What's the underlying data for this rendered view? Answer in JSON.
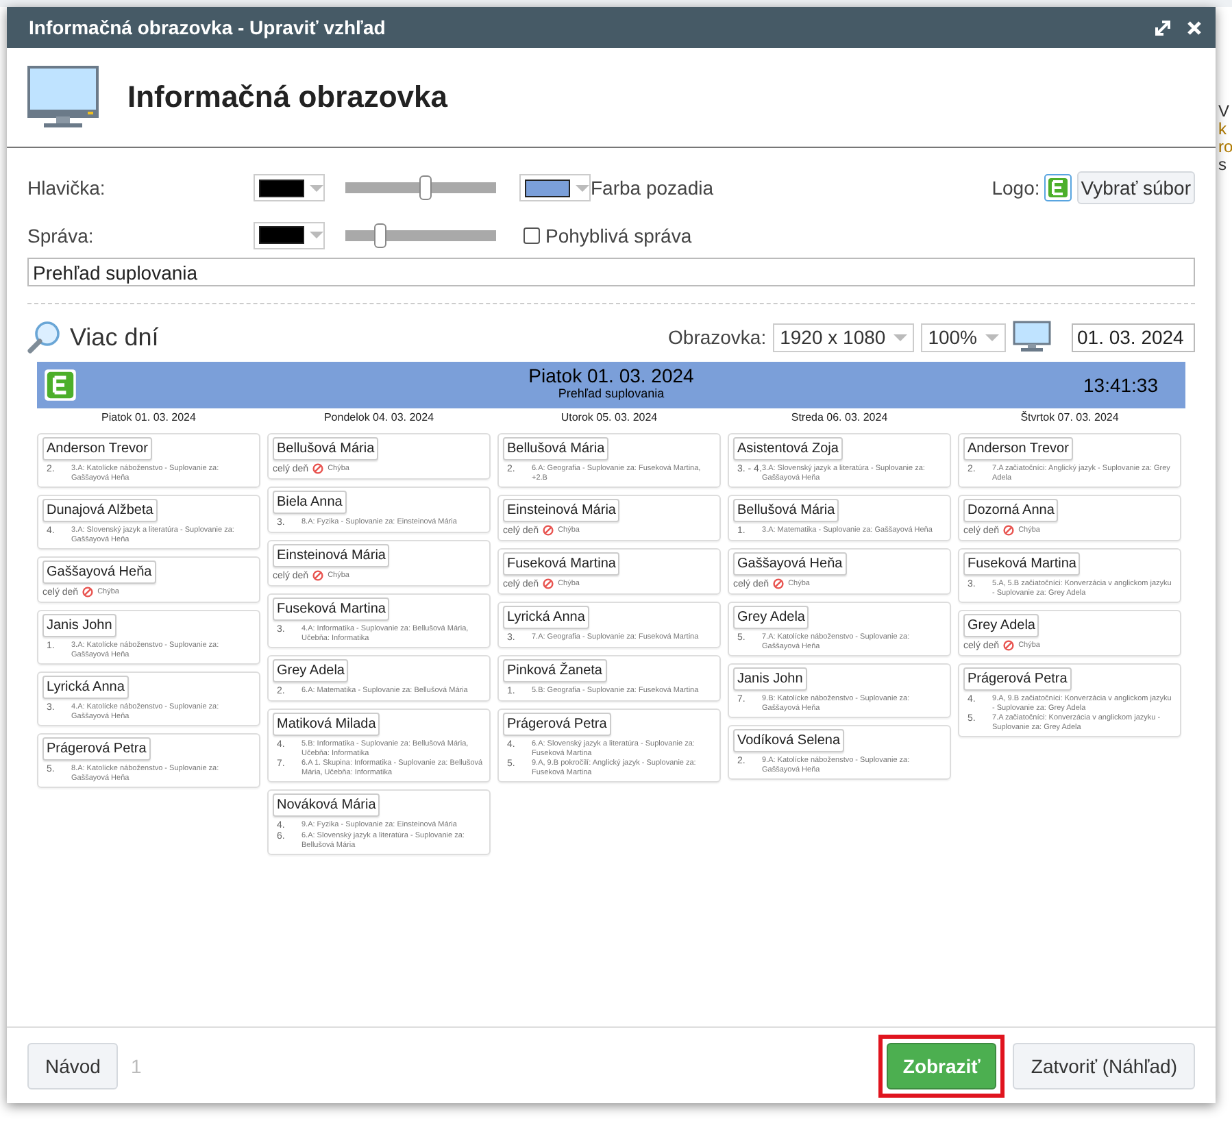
{
  "background": {
    "side_text": [
      "V",
      "k",
      "ro",
      "s"
    ]
  },
  "window": {
    "title": "Informačná obrazovka - Upraviť vzhľad"
  },
  "heading": "Informačná obrazovka",
  "settings": {
    "header": {
      "label": "Hlavička:",
      "text_picker": {
        "color": "#000000"
      },
      "level": 0.54,
      "bg_picker": {
        "color": "#7b9fd9"
      },
      "bg_label": "Farba pozadia"
    },
    "message": {
      "label": "Správa:",
      "text_picker": {
        "color": "#000000"
      },
      "level": 0.24,
      "moving_label": "Pohyblivá správa",
      "moving_checked": false
    },
    "logo_label": "Logo:",
    "file_button": "Vybrať súbor",
    "message_value": "Prehľad suplovania"
  },
  "toolbar": {
    "mode": "Viac dní",
    "screen_label": "Obrazovka:",
    "resolution": "1920 x 1080",
    "zoom": "100%",
    "date": "01. 03. 2024"
  },
  "preview": {
    "date": "Piatok 01. 03. 2024",
    "subtitle": "Prehľad suplovania",
    "time": "13:41:33",
    "days": [
      {
        "title": "Piatok 01. 03. 2024",
        "entries": [
          {
            "name": "Anderson Trevor",
            "kind": "lessons",
            "lessons": [
              {
                "period": "2.",
                "text": "3.A: Katolícke náboženstvo - Suplovanie za: Gaššayová Heňa"
              }
            ]
          },
          {
            "name": "Dunajová Alžbeta",
            "kind": "lessons",
            "lessons": [
              {
                "period": "4.",
                "text": "3.A: Slovenský jazyk a literatúra - Suplovanie za: Gaššayová Heňa"
              }
            ]
          },
          {
            "name": "Gaššayová Heňa",
            "kind": "absent",
            "all_day": "celý deň",
            "status": "Chýba"
          },
          {
            "name": "Janis John",
            "kind": "lessons",
            "lessons": [
              {
                "period": "1.",
                "text": "3.A: Katolícke náboženstvo - Suplovanie za: Gaššayová Heňa"
              }
            ]
          },
          {
            "name": "Lyrická Anna",
            "kind": "lessons",
            "lessons": [
              {
                "period": "3.",
                "text": "4.A: Katolícke náboženstvo - Suplovanie za: Gaššayová Heňa"
              }
            ]
          },
          {
            "name": "Prágerová Petra",
            "kind": "lessons",
            "lessons": [
              {
                "period": "5.",
                "text": "8.A: Katolícke náboženstvo - Suplovanie za: Gaššayová Heňa"
              }
            ]
          }
        ]
      },
      {
        "title": "Pondelok 04. 03. 2024",
        "entries": [
          {
            "name": "Bellušová Mária",
            "kind": "absent",
            "all_day": "celý deň",
            "status": "Chýba"
          },
          {
            "name": "Biela Anna",
            "kind": "lessons",
            "lessons": [
              {
                "period": "3.",
                "text": "8.A: Fyzika - Suplovanie za: Einsteinová Mária"
              }
            ]
          },
          {
            "name": "Einsteinová Mária",
            "kind": "absent",
            "all_day": "celý deň",
            "status": "Chýba"
          },
          {
            "name": "Fuseková Martina",
            "kind": "lessons",
            "lessons": [
              {
                "period": "3.",
                "text": "4.A: Informatika - Suplovanie za: Bellušová Mária, Učebňa: Informatika"
              }
            ]
          },
          {
            "name": "Grey Adela",
            "kind": "lessons",
            "lessons": [
              {
                "period": "2.",
                "text": "6.A: Matematika - Suplovanie za: Bellušová Mária"
              }
            ]
          },
          {
            "name": "Matiková Milada",
            "kind": "lessons",
            "lessons": [
              {
                "period": "4.",
                "text": "5.B: Informatika - Suplovanie za: Bellušová Mária, Učebňa: Informatika"
              },
              {
                "period": "7.",
                "text": "6.A 1. Skupina: Informatika - Suplovanie za: Bellušová Mária, Učebňa: Informatika"
              }
            ]
          },
          {
            "name": "Nováková Mária",
            "kind": "lessons",
            "lessons": [
              {
                "period": "4.",
                "text": "9.A: Fyzika - Suplovanie za: Einsteinová Mária"
              },
              {
                "period": "6.",
                "text": "6.A: Slovenský jazyk a literatúra - Suplovanie za: Bellušová Mária"
              }
            ]
          }
        ]
      },
      {
        "title": "Utorok 05. 03. 2024",
        "entries": [
          {
            "name": "Bellušová Mária",
            "kind": "lessons",
            "lessons": [
              {
                "period": "2.",
                "text": "6.A: Geografia - Suplovanie za: Fuseková Martina, +2.B"
              }
            ]
          },
          {
            "name": "Einsteinová Mária",
            "kind": "absent",
            "all_day": "celý deň",
            "status": "Chýba"
          },
          {
            "name": "Fuseková Martina",
            "kind": "absent",
            "all_day": "celý deň",
            "status": "Chýba"
          },
          {
            "name": "Lyrická Anna",
            "kind": "lessons",
            "lessons": [
              {
                "period": "3.",
                "text": "7.A: Geografia - Suplovanie za: Fuseková Martina"
              }
            ]
          },
          {
            "name": "Pinková Žaneta",
            "kind": "lessons",
            "lessons": [
              {
                "period": "1.",
                "text": "5.B: Geografia - Suplovanie za: Fuseková Martina"
              }
            ]
          },
          {
            "name": "Prágerová Petra",
            "kind": "lessons",
            "lessons": [
              {
                "period": "4.",
                "text": "6.A: Slovenský jazyk a literatúra - Suplovanie za: Fuseková Martina"
              },
              {
                "period": "5.",
                "text": "9.A, 9.B pokročilí: Anglický jazyk - Suplovanie za: Fuseková Martina"
              }
            ]
          }
        ]
      },
      {
        "title": "Streda 06. 03. 2024",
        "entries": [
          {
            "name": "Asistentová Zoja",
            "kind": "lessons",
            "lessons": [
              {
                "period": "3. - 4.",
                "text": "3.A: Slovenský jazyk a literatúra - Suplovanie za: Gaššayová Heňa"
              }
            ]
          },
          {
            "name": "Bellušová Mária",
            "kind": "lessons",
            "lessons": [
              {
                "period": "1.",
                "text": "3.A: Matematika - Suplovanie za: Gaššayová Heňa"
              }
            ]
          },
          {
            "name": "Gaššayová Heňa",
            "kind": "absent",
            "all_day": "celý deň",
            "status": "Chýba"
          },
          {
            "name": "Grey Adela",
            "kind": "lessons",
            "lessons": [
              {
                "period": "5.",
                "text": "7.A: Katolícke náboženstvo - Suplovanie za: Gaššayová Heňa"
              }
            ]
          },
          {
            "name": "Janis John",
            "kind": "lessons",
            "lessons": [
              {
                "period": "7.",
                "text": "9.B: Katolícke náboženstvo - Suplovanie za: Gaššayová Heňa"
              }
            ]
          },
          {
            "name": "Vodíková Selena",
            "kind": "lessons",
            "lessons": [
              {
                "period": "2.",
                "text": "9.A: Katolícke náboženstvo - Suplovanie za: Gaššayová Heňa"
              }
            ]
          }
        ]
      },
      {
        "title": "Štvrtok 07. 03. 2024",
        "entries": [
          {
            "name": "Anderson Trevor",
            "kind": "lessons",
            "lessons": [
              {
                "period": "2.",
                "text": "7.A začiatočníci: Anglický jazyk - Suplovanie za: Grey Adela"
              }
            ]
          },
          {
            "name": "Dozorná Anna",
            "kind": "absent",
            "all_day": "celý deň",
            "status": "Chýba"
          },
          {
            "name": "Fuseková Martina",
            "kind": "lessons",
            "lessons": [
              {
                "period": "3.",
                "text": "5.A, 5.B začiatočníci: Konverzácia v anglickom jazyku - Suplovanie za: Grey Adela"
              }
            ]
          },
          {
            "name": "Grey Adela",
            "kind": "absent",
            "all_day": "celý deň",
            "status": "Chýba"
          },
          {
            "name": "Prágerová Petra",
            "kind": "lessons",
            "lessons": [
              {
                "period": "4.",
                "text": "9.A, 9.B začiatočníci: Konverzácia v anglickom jazyku - Suplovanie za: Grey Adela"
              },
              {
                "period": "5.",
                "text": "7.A začiatočníci: Konverzácia v anglickom jazyku - Suplovanie za: Grey Adela"
              }
            ]
          }
        ]
      }
    ]
  },
  "footer": {
    "help_button": "Návod",
    "page": "1",
    "show_button": {
      "label": "Zobraziť",
      "highlighted": true
    },
    "close_button": "Zatvoriť (Náhľad)"
  }
}
